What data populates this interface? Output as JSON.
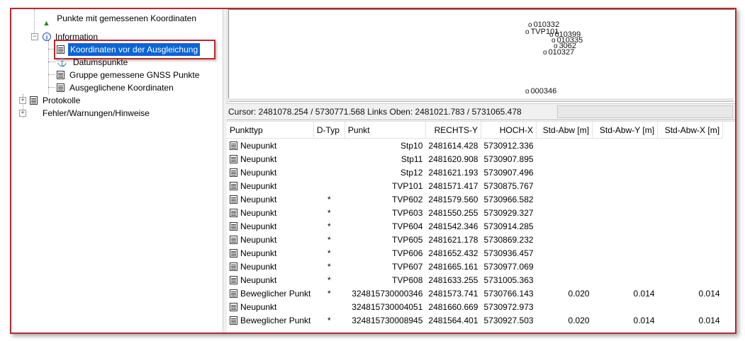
{
  "tree": {
    "items": [
      {
        "label": "Punkte mit gemessenen Koordinaten"
      },
      {
        "label": "Information"
      },
      {
        "label": "Koordinaten vor der Ausgleichung"
      },
      {
        "label": "Datumspunkte"
      },
      {
        "label": "Gruppe gemessene GNSS Punkte"
      },
      {
        "label": "Ausgeglichene Koordinaten"
      },
      {
        "label": "Protokolle"
      },
      {
        "label": "Fehler/Warnungen/Hinweise"
      }
    ]
  },
  "map": {
    "points": [
      "010332",
      "TVP101",
      "010399",
      "010335",
      "3062",
      "010327",
      "000346"
    ]
  },
  "status": {
    "text": "Cursor: 2481078.254 / 5730771.568 Links Oben: 2481021.783 / 5731065.478"
  },
  "table": {
    "headers": [
      "Punkttyp",
      "D-Typ",
      "Punkt",
      "RECHTS-Y",
      "HOCH-X",
      "Std-Abw [m]",
      "Std-Abw-Y [m]",
      "Std-Abw-X [m]"
    ],
    "rows": [
      {
        "typ": "Neupunkt",
        "dtyp": "",
        "punkt": "Stp10",
        "y": "2481614.428",
        "x": "5730912.336",
        "sa": "",
        "say": "",
        "sax": ""
      },
      {
        "typ": "Neupunkt",
        "dtyp": "",
        "punkt": "Stp11",
        "y": "2481620.908",
        "x": "5730907.895",
        "sa": "",
        "say": "",
        "sax": ""
      },
      {
        "typ": "Neupunkt",
        "dtyp": "",
        "punkt": "Stp12",
        "y": "2481621.193",
        "x": "5730907.496",
        "sa": "",
        "say": "",
        "sax": ""
      },
      {
        "typ": "Neupunkt",
        "dtyp": "",
        "punkt": "TVP101",
        "y": "2481571.417",
        "x": "5730875.767",
        "sa": "",
        "say": "",
        "sax": ""
      },
      {
        "typ": "Neupunkt",
        "dtyp": "*",
        "punkt": "TVP602",
        "y": "2481579.560",
        "x": "5730966.582",
        "sa": "",
        "say": "",
        "sax": ""
      },
      {
        "typ": "Neupunkt",
        "dtyp": "*",
        "punkt": "TVP603",
        "y": "2481550.255",
        "x": "5730929.327",
        "sa": "",
        "say": "",
        "sax": ""
      },
      {
        "typ": "Neupunkt",
        "dtyp": "*",
        "punkt": "TVP604",
        "y": "2481542.346",
        "x": "5730914.285",
        "sa": "",
        "say": "",
        "sax": ""
      },
      {
        "typ": "Neupunkt",
        "dtyp": "*",
        "punkt": "TVP605",
        "y": "2481621.178",
        "x": "5730869.232",
        "sa": "",
        "say": "",
        "sax": ""
      },
      {
        "typ": "Neupunkt",
        "dtyp": "*",
        "punkt": "TVP606",
        "y": "2481652.432",
        "x": "5730936.457",
        "sa": "",
        "say": "",
        "sax": ""
      },
      {
        "typ": "Neupunkt",
        "dtyp": "*",
        "punkt": "TVP607",
        "y": "2481665.161",
        "x": "5730977.069",
        "sa": "",
        "say": "",
        "sax": ""
      },
      {
        "typ": "Neupunkt",
        "dtyp": "*",
        "punkt": "TVP608",
        "y": "2481633.255",
        "x": "5731005.363",
        "sa": "",
        "say": "",
        "sax": ""
      },
      {
        "typ": "Beweglicher Punkt",
        "dtyp": "*",
        "punkt": "324815730000346",
        "y": "2481573.741",
        "x": "5730766.143",
        "sa": "0.020",
        "say": "0.014",
        "sax": "0.014"
      },
      {
        "typ": "Neupunkt",
        "dtyp": "",
        "punkt": "324815730004051",
        "y": "2481660.669",
        "x": "5730972.973",
        "sa": "",
        "say": "",
        "sax": ""
      },
      {
        "typ": "Beweglicher Punkt",
        "dtyp": "*",
        "punkt": "324815730008945",
        "y": "2481564.401",
        "x": "5730927.503",
        "sa": "0.020",
        "say": "0.014",
        "sax": "0.014"
      }
    ]
  }
}
